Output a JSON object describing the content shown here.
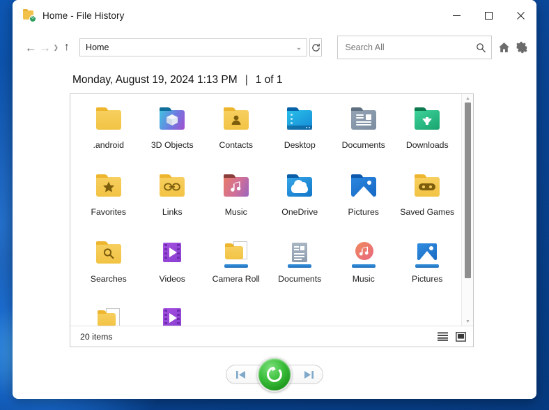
{
  "window": {
    "title": "Home - File History",
    "title_icon": "file-history-folder-icon",
    "controls": {
      "minimize": "–",
      "maximize": "□",
      "close": "✕"
    }
  },
  "toolbar": {
    "back_icon": "arrow-left-icon",
    "forward_icon": "arrow-right-icon",
    "recent_icon": "chevron-down-icon",
    "up_icon": "arrow-up-icon",
    "address_value": "Home",
    "address_chevron": "⌄",
    "refresh_icon": "refresh-icon",
    "search_placeholder": "Search All",
    "search_icon": "search-icon",
    "home_icon": "home-icon",
    "settings_icon": "gear-icon"
  },
  "header": {
    "timestamp": "Monday, August 19, 2024 1:13 PM",
    "separator": "|",
    "version_counter": "1 of 1"
  },
  "grid": {
    "items": [
      {
        "label": ".android",
        "icon": "folder-plain-icon"
      },
      {
        "label": "3D Objects",
        "icon": "folder-3d-objects-icon"
      },
      {
        "label": "Contacts",
        "icon": "folder-contacts-icon"
      },
      {
        "label": "Desktop",
        "icon": "folder-desktop-icon"
      },
      {
        "label": "Documents",
        "icon": "folder-documents-icon"
      },
      {
        "label": "Downloads",
        "icon": "folder-downloads-icon"
      },
      {
        "label": "Favorites",
        "icon": "folder-favorites-icon"
      },
      {
        "label": "Links",
        "icon": "folder-links-icon"
      },
      {
        "label": "Music",
        "icon": "folder-music-icon"
      },
      {
        "label": "OneDrive",
        "icon": "folder-onedrive-icon"
      },
      {
        "label": "Pictures",
        "icon": "folder-pictures-icon"
      },
      {
        "label": "Saved Games",
        "icon": "folder-saved-games-icon"
      },
      {
        "label": "Searches",
        "icon": "folder-searches-icon"
      },
      {
        "label": "Videos",
        "icon": "folder-videos-icon"
      },
      {
        "label": "Camera Roll",
        "icon": "library-camera-roll-icon"
      },
      {
        "label": "Documents",
        "icon": "library-documents-icon"
      },
      {
        "label": "Music",
        "icon": "library-music-icon"
      },
      {
        "label": "Pictures",
        "icon": "library-pictures-icon"
      },
      {
        "label": "",
        "icon": "library-camera-roll-icon"
      },
      {
        "label": "",
        "icon": "library-videos-icon"
      }
    ]
  },
  "statusbar": {
    "item_count": "20 items",
    "details_view_icon": "details-view-icon",
    "large_icons_view_icon": "large-icons-view-icon"
  },
  "bottom_nav": {
    "previous_label": "previous-version-icon",
    "restore_label": "restore-icon",
    "next_label": "next-version-icon"
  },
  "colors": {
    "accent": "#0a4a99",
    "restore_green": "#2fae2f",
    "folder_yellow": "#f2c344"
  }
}
